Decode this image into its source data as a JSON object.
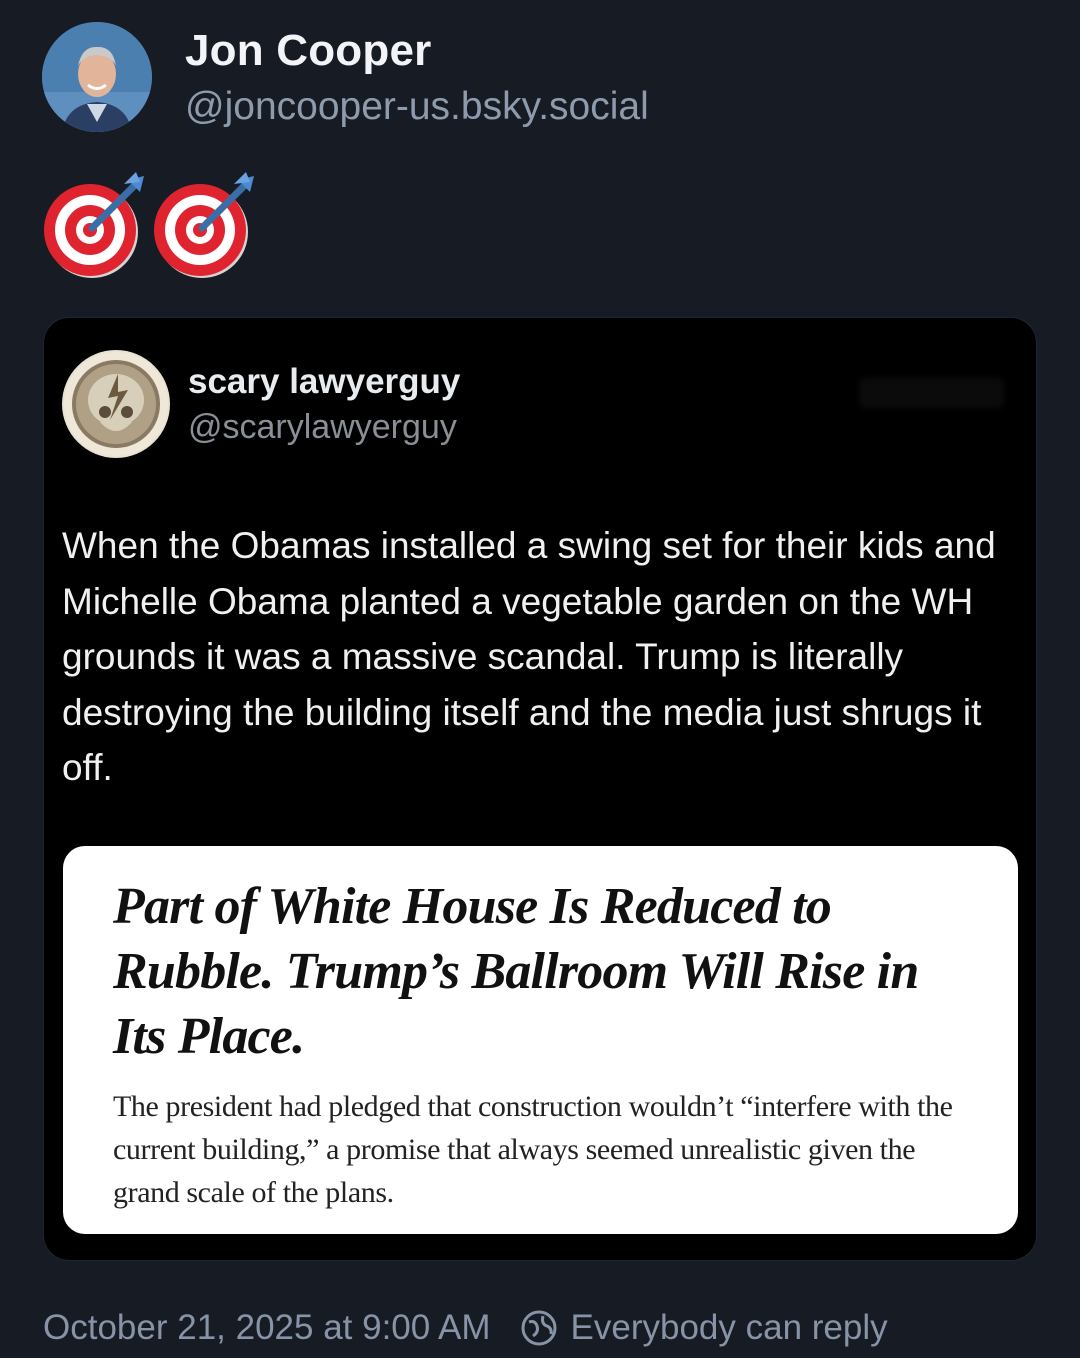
{
  "post": {
    "author": {
      "name": "Jon Cooper",
      "handle": "@joncooper-us.bsky.social",
      "avatar": "avatar-photo"
    },
    "emoji": [
      "direct-hit-icon",
      "direct-hit-icon"
    ],
    "quote": {
      "author": {
        "name": "scary lawyerguy",
        "handle": "@scarylawyerguy",
        "avatar": "steal-your-face-skull-icon"
      },
      "text": "When the Obamas installed a swing set for their kids and Michelle Obama planted a vegetable garden on the WH grounds it was a massive scandal. Trump is literally destroying the building itself and the media just shrugs it off.",
      "image": {
        "headline": "Part of White House Is Reduced to Rubble. Trump’s Ballroom Will Rise in Its Place.",
        "summary": "The president had pledged that construction wouldn’t “interfere with the current building,” a promise that always seemed unrealistic given the grand scale of the plans."
      }
    },
    "footer": {
      "timestamp": "October 21, 2025 at 9:00 AM",
      "reply_setting": "Everybody can reply",
      "reply_icon": "globe-icon"
    }
  },
  "colors": {
    "background": "#161b24",
    "card": "#000000",
    "name": "#f2f4f7",
    "muted": "#8e9bad"
  }
}
